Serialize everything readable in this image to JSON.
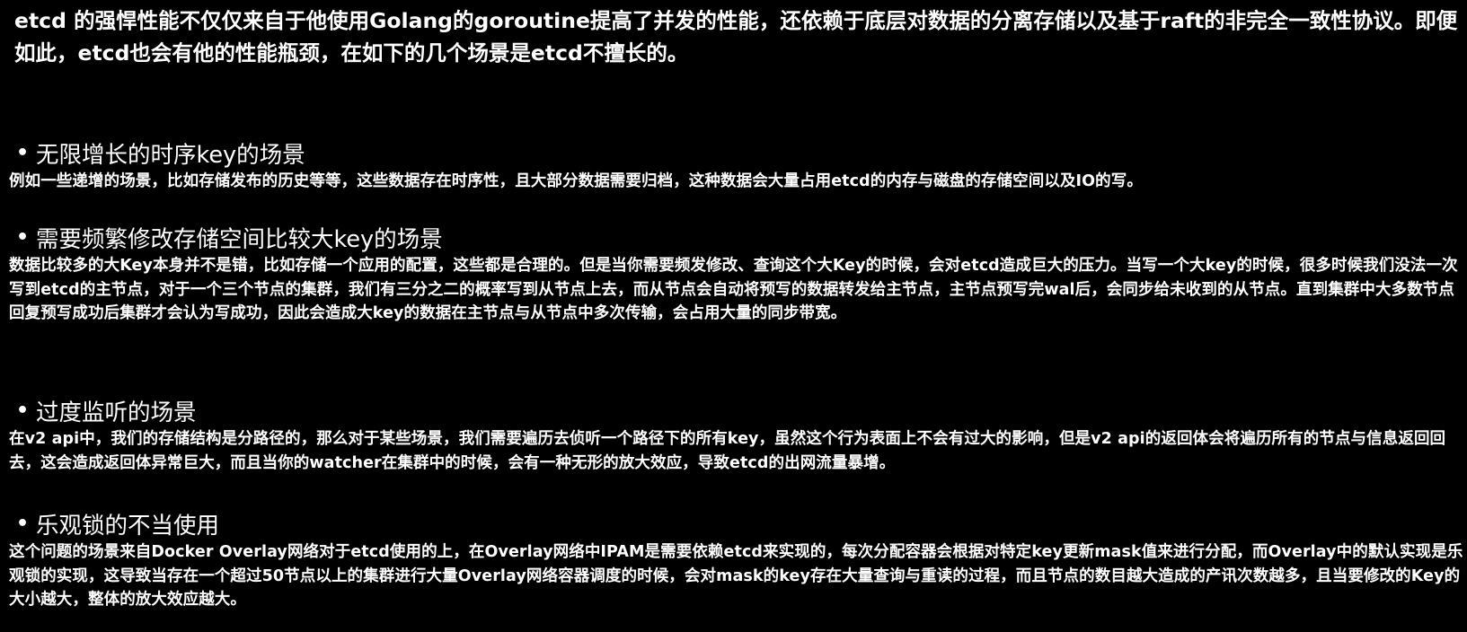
{
  "intro": "etcd 的强悍性能不仅仅来自于他使用Golang的goroutine提高了并发的性能，还依赖于底层对数据的分离存储以及基于raft的非完全一致性协议。即便如此，etcd也会有他的性能瓶颈，在如下的几个场景是etcd不擅长的。",
  "sections": [
    {
      "bullet": "•",
      "title": "无限增长的时序key的场景",
      "body": "例如一些递增的场景，比如存储发布的历史等等，这些数据存在时序性，且大部分数据需要归档，这种数据会大量占用etcd的内存与磁盘的存储空间以及IO的写。"
    },
    {
      "bullet": "•",
      "title": "需要频繁修改存储空间比较大key的场景",
      "body": "数据比较多的大Key本身并不是错，比如存储一个应用的配置，这些都是合理的。但是当你需要频发修改、查询这个大Key的时候，会对etcd造成巨大的压力。当写一个大key的时候，很多时候我们没法一次写到etcd的主节点，对于一个三个节点的集群，我们有三分之二的概率写到从节点上去，而从节点会自动将预写的数据转发给主节点，主节点预写完wal后，会同步给未收到的从节点。直到集群中大多数节点回复预写成功后集群才会认为写成功，因此会造成大key的数据在主节点与从节点中多次传输，会占用大量的同步带宽。"
    },
    {
      "bullet": "•",
      "title": "过度监听的场景",
      "body": "在v2 api中，我们的存储结构是分路径的，那么对于某些场景，我们需要遍历去侦听一个路径下的所有key，虽然这个行为表面上不会有过大的影响，但是v2 api的返回体会将遍历所有的节点与信息返回回去，这会造成返回体异常巨大，而且当你的watcher在集群中的时候，会有一种无形的放大效应，导致etcd的出网流量暴增。"
    },
    {
      "bullet": "•",
      "title": "乐观锁的不当使用",
      "body": "这个问题的场景来自Docker Overlay网络对于etcd使用的上，在Overlay网络中IPAM是需要依赖etcd来实现的，每次分配容器会根据对特定key更新mask值来进行分配，而Overlay中的默认实现是乐观锁的实现，这导致当存在一个超过50节点以上的集群进行大量Overlay网络容器调度的时候，会对mask的key存在大量查询与重读的过程，而且节点的数目越大造成的产讯次数越多，且当要修改的Key的大小越大，整体的放大效应越大。"
    }
  ]
}
